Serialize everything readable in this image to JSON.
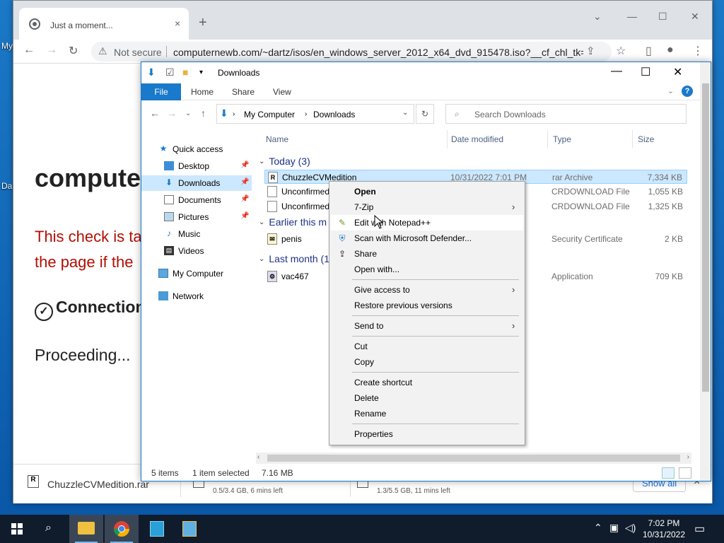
{
  "desktop": {
    "label_1": "My",
    "label_2": "Da"
  },
  "browser": {
    "tab_title": "Just a moment...",
    "tab_close": "×",
    "new_tab": "+",
    "not_secure": "Not secure",
    "url": "computernewb.com/~dartz/isos/en_windows_server_2012_x64_dvd_915478.iso?__cf_chl_tk=..."
  },
  "page": {
    "title": "compute",
    "check_text_1": "This check is ta",
    "check_text_2": "the page if the",
    "connection": "Connection",
    "proceeding": "Proceeding..."
  },
  "downloads": {
    "item1_name": "ChuzzleCVMedition.rar",
    "item2_name": "-",
    "item2_status": "0.5/3.4 GB, 6 mins left",
    "item3_name": "-",
    "item3_status": "1.3/5.5 GB, 11 mins left",
    "show_all": "Show all",
    "close": "×"
  },
  "explorer": {
    "title": "Downloads",
    "ribbon": {
      "file": "File",
      "home": "Home",
      "share": "Share",
      "view": "View",
      "help": "?"
    },
    "address": {
      "crumb1": "My Computer",
      "crumb2": "Downloads"
    },
    "search_placeholder": "Search Downloads",
    "nav": [
      {
        "label": "Quick access"
      },
      {
        "label": "Desktop"
      },
      {
        "label": "Downloads"
      },
      {
        "label": "Documents"
      },
      {
        "label": "Pictures"
      },
      {
        "label": "Music"
      },
      {
        "label": "Videos"
      },
      {
        "label": "My Computer"
      },
      {
        "label": "Network"
      }
    ],
    "columns": {
      "name": "Name",
      "date": "Date modified",
      "type": "Type",
      "size": "Size"
    },
    "groups": {
      "today": "Today (3)",
      "earlier": "Earlier this m",
      "last_month": "Last month (1"
    },
    "files": [
      {
        "name": "ChuzzleCVMedition",
        "date": "10/31/2022 7:01 PM",
        "type": "rar Archive",
        "size": "7,334 KB"
      },
      {
        "name": "Unconfirmed",
        "date": "",
        "type": "CRDOWNLOAD File",
        "size": "1,055 KB"
      },
      {
        "name": "Unconfirmed",
        "date": "",
        "type": "CRDOWNLOAD File",
        "size": "1,325 KB"
      },
      {
        "name": "penis",
        "date": "",
        "type": "Security Certificate",
        "size": "2 KB"
      },
      {
        "name": "vac467",
        "date": "",
        "type": "Application",
        "size": "709 KB"
      }
    ],
    "status": {
      "items": "5 items",
      "selected": "1 item selected",
      "size": "7.16 MB"
    }
  },
  "context_menu": {
    "items": [
      {
        "label": "Open"
      },
      {
        "label": "7-Zip"
      },
      {
        "label": "Edit with Notepad++"
      },
      {
        "label": "Scan with Microsoft Defender..."
      },
      {
        "label": "Share"
      },
      {
        "label": "Open with..."
      },
      {
        "label": "Give access to"
      },
      {
        "label": "Restore previous versions"
      },
      {
        "label": "Send to"
      },
      {
        "label": "Cut"
      },
      {
        "label": "Copy"
      },
      {
        "label": "Create shortcut"
      },
      {
        "label": "Delete"
      },
      {
        "label": "Rename"
      },
      {
        "label": "Properties"
      }
    ]
  },
  "taskbar": {
    "time": "7:02 PM",
    "date": "10/31/2022"
  },
  "colors": {
    "accent": "#1979ca",
    "selection": "#cce8ff",
    "cf_error": "#b20f03"
  }
}
